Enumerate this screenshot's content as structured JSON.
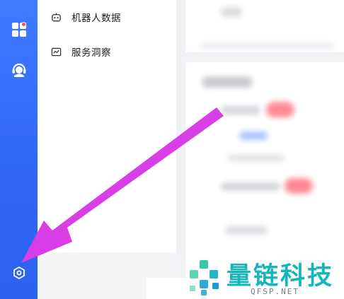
{
  "menu": {
    "items": [
      {
        "label": "机器人数据",
        "icon": "robot-icon"
      },
      {
        "label": "服务洞察",
        "icon": "insight-chart-icon"
      }
    ]
  },
  "rail": {
    "icons": [
      "apps-grid-icon",
      "customer-service-icon",
      "settings-gear-icon"
    ]
  },
  "watermark": {
    "brand": "量链科技",
    "domain": "QFSP.NET"
  },
  "colors": {
    "rail": "#2f66f6",
    "annotation_arrow": "#d93ee6",
    "watermark": "#15b6b8",
    "badge": "#ff4d4f"
  }
}
